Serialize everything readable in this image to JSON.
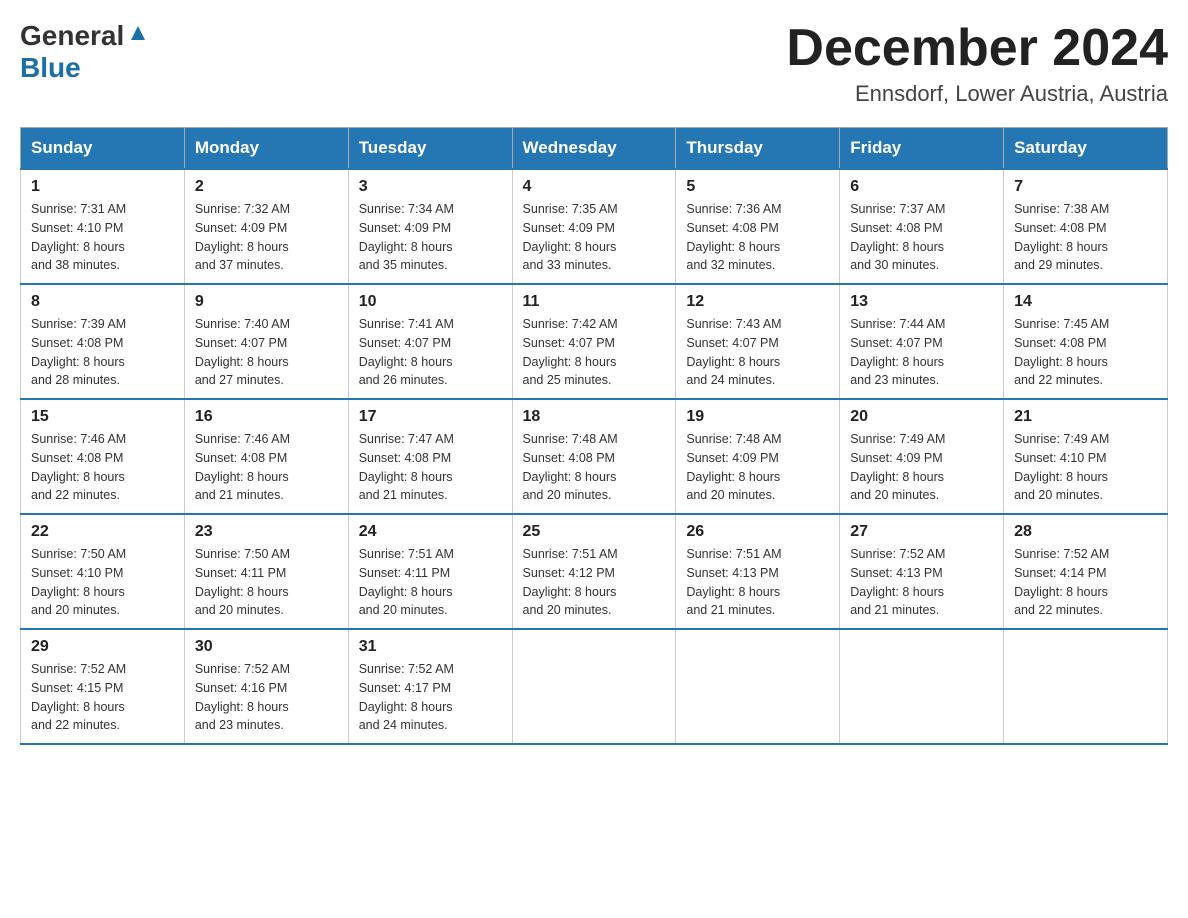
{
  "header": {
    "logo_general": "General",
    "logo_blue": "Blue",
    "title": "December 2024",
    "subtitle": "Ennsdorf, Lower Austria, Austria"
  },
  "days_of_week": [
    "Sunday",
    "Monday",
    "Tuesday",
    "Wednesday",
    "Thursday",
    "Friday",
    "Saturday"
  ],
  "weeks": [
    [
      {
        "day": "1",
        "sunrise": "7:31 AM",
        "sunset": "4:10 PM",
        "daylight": "8 hours and 38 minutes."
      },
      {
        "day": "2",
        "sunrise": "7:32 AM",
        "sunset": "4:09 PM",
        "daylight": "8 hours and 37 minutes."
      },
      {
        "day": "3",
        "sunrise": "7:34 AM",
        "sunset": "4:09 PM",
        "daylight": "8 hours and 35 minutes."
      },
      {
        "day": "4",
        "sunrise": "7:35 AM",
        "sunset": "4:09 PM",
        "daylight": "8 hours and 33 minutes."
      },
      {
        "day": "5",
        "sunrise": "7:36 AM",
        "sunset": "4:08 PM",
        "daylight": "8 hours and 32 minutes."
      },
      {
        "day": "6",
        "sunrise": "7:37 AM",
        "sunset": "4:08 PM",
        "daylight": "8 hours and 30 minutes."
      },
      {
        "day": "7",
        "sunrise": "7:38 AM",
        "sunset": "4:08 PM",
        "daylight": "8 hours and 29 minutes."
      }
    ],
    [
      {
        "day": "8",
        "sunrise": "7:39 AM",
        "sunset": "4:08 PM",
        "daylight": "8 hours and 28 minutes."
      },
      {
        "day": "9",
        "sunrise": "7:40 AM",
        "sunset": "4:07 PM",
        "daylight": "8 hours and 27 minutes."
      },
      {
        "day": "10",
        "sunrise": "7:41 AM",
        "sunset": "4:07 PM",
        "daylight": "8 hours and 26 minutes."
      },
      {
        "day": "11",
        "sunrise": "7:42 AM",
        "sunset": "4:07 PM",
        "daylight": "8 hours and 25 minutes."
      },
      {
        "day": "12",
        "sunrise": "7:43 AM",
        "sunset": "4:07 PM",
        "daylight": "8 hours and 24 minutes."
      },
      {
        "day": "13",
        "sunrise": "7:44 AM",
        "sunset": "4:07 PM",
        "daylight": "8 hours and 23 minutes."
      },
      {
        "day": "14",
        "sunrise": "7:45 AM",
        "sunset": "4:08 PM",
        "daylight": "8 hours and 22 minutes."
      }
    ],
    [
      {
        "day": "15",
        "sunrise": "7:46 AM",
        "sunset": "4:08 PM",
        "daylight": "8 hours and 22 minutes."
      },
      {
        "day": "16",
        "sunrise": "7:46 AM",
        "sunset": "4:08 PM",
        "daylight": "8 hours and 21 minutes."
      },
      {
        "day": "17",
        "sunrise": "7:47 AM",
        "sunset": "4:08 PM",
        "daylight": "8 hours and 21 minutes."
      },
      {
        "day": "18",
        "sunrise": "7:48 AM",
        "sunset": "4:08 PM",
        "daylight": "8 hours and 20 minutes."
      },
      {
        "day": "19",
        "sunrise": "7:48 AM",
        "sunset": "4:09 PM",
        "daylight": "8 hours and 20 minutes."
      },
      {
        "day": "20",
        "sunrise": "7:49 AM",
        "sunset": "4:09 PM",
        "daylight": "8 hours and 20 minutes."
      },
      {
        "day": "21",
        "sunrise": "7:49 AM",
        "sunset": "4:10 PM",
        "daylight": "8 hours and 20 minutes."
      }
    ],
    [
      {
        "day": "22",
        "sunrise": "7:50 AM",
        "sunset": "4:10 PM",
        "daylight": "8 hours and 20 minutes."
      },
      {
        "day": "23",
        "sunrise": "7:50 AM",
        "sunset": "4:11 PM",
        "daylight": "8 hours and 20 minutes."
      },
      {
        "day": "24",
        "sunrise": "7:51 AM",
        "sunset": "4:11 PM",
        "daylight": "8 hours and 20 minutes."
      },
      {
        "day": "25",
        "sunrise": "7:51 AM",
        "sunset": "4:12 PM",
        "daylight": "8 hours and 20 minutes."
      },
      {
        "day": "26",
        "sunrise": "7:51 AM",
        "sunset": "4:13 PM",
        "daylight": "8 hours and 21 minutes."
      },
      {
        "day": "27",
        "sunrise": "7:52 AM",
        "sunset": "4:13 PM",
        "daylight": "8 hours and 21 minutes."
      },
      {
        "day": "28",
        "sunrise": "7:52 AM",
        "sunset": "4:14 PM",
        "daylight": "8 hours and 22 minutes."
      }
    ],
    [
      {
        "day": "29",
        "sunrise": "7:52 AM",
        "sunset": "4:15 PM",
        "daylight": "8 hours and 22 minutes."
      },
      {
        "day": "30",
        "sunrise": "7:52 AM",
        "sunset": "4:16 PM",
        "daylight": "8 hours and 23 minutes."
      },
      {
        "day": "31",
        "sunrise": "7:52 AM",
        "sunset": "4:17 PM",
        "daylight": "8 hours and 24 minutes."
      },
      null,
      null,
      null,
      null
    ]
  ],
  "labels": {
    "sunrise": "Sunrise:",
    "sunset": "Sunset:",
    "daylight": "Daylight:"
  }
}
